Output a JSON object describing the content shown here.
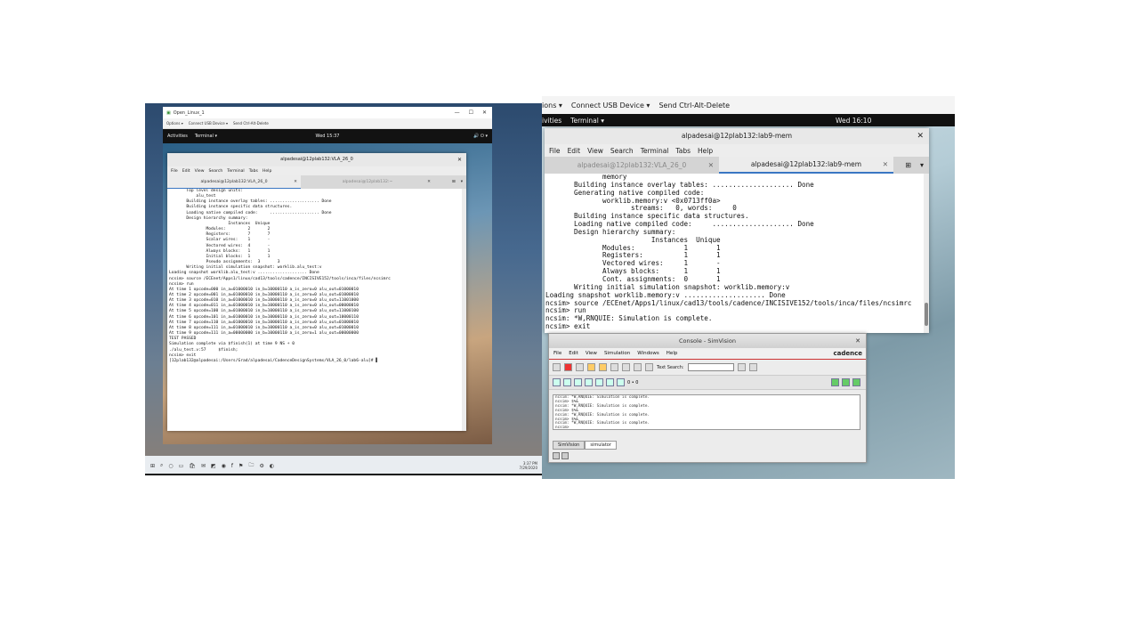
{
  "left": {
    "rdp_title": "Open_Linux_1",
    "rdp_toolbar": [
      "Options ▾",
      "Connect USB Device ▾",
      "Send Ctrl-Alt-Delete"
    ],
    "gnome": {
      "activities": "Activities",
      "app": "Terminal ▾",
      "clock": "Wed 15:37"
    },
    "terminal": {
      "title": "alpadesai@12plab132:VLA_26_0",
      "menu": [
        "File",
        "Edit",
        "View",
        "Search",
        "Terminal",
        "Tabs",
        "Help"
      ],
      "tabs": [
        "alpadesai@12plab132:VLA_26_0",
        "alpadesai@12plab132:~"
      ],
      "lines": [
        "       Top level design units:",
        "           alu_test",
        "       Building instance overlay tables: .................... Done",
        "       Building instance specific data structures.",
        "       Loading native compiled code:     .................... Done",
        "       Design hierarchy summary:",
        "                        Instances  Unique",
        "               Modules:         2       2",
        "               Registers:       7       7",
        "               Scalar wires:    1       -",
        "               Vectored wires:  4       -",
        "               Always blocks:   1       1",
        "               Initial blocks:  1       1",
        "               Pseudo assignments:  3       3",
        "       Writing initial simulation snapshot: worklib.alu_test:v",
        "Loading snapshot worklib.alu_test:v .................... Done",
        "ncsim> source /ECEnet/Apps1/linux/cad13/tools/cadence/INCISIVE152/tools/inca/files/ncsimrc",
        "ncsim> run",
        "At time 1 opcode=000 in_a=01000010 in_b=10000110 a_is_zero=0 alu_out=01000010",
        "At time 2 opcode=001 in_a=01000010 in_b=10000110 a_is_zero=0 alu_out=01000010",
        "At time 3 opcode=010 in_a=01000010 in_b=10000110 a_is_zero=0 alu_out=11001000",
        "At time 4 opcode=011 in_a=01000010 in_b=10000110 a_is_zero=0 alu_out=00000010",
        "At time 5 opcode=100 in_a=01000010 in_b=10000110 a_is_zero=0 alu_out=11000100",
        "At time 6 opcode=101 in_a=01000010 in_b=10000110 a_is_zero=0 alu_out=10000110",
        "At time 7 opcode=110 in_a=01000010 in_b=10000110 a_is_zero=0 alu_out=01000010",
        "At time 8 opcode=111 in_a=01000010 in_b=10000110 a_is_zero=0 alu_out=01000010",
        "At time 9 opcode=111 in_a=00000000 in_b=10000110 a_is_zero=1 alu_out=00000000",
        "TEST PASSED",
        "Simulation complete via $finish(1) at time 9 NS + 0",
        "./alu_test.v:57     $finish;",
        "ncsim> exit",
        "[12plab132@alpadesai:/Users/Grad/alpadesai/CadenceDesignSystems/VLA_26_0/lab6-alu]# ▌"
      ]
    },
    "taskbar_clock": [
      "3:37 PM",
      "7/29/2020"
    ]
  },
  "right": {
    "rdp_toolbar": [
      "ions ▾",
      "Connect USB Device ▾",
      "Send Ctrl-Alt-Delete"
    ],
    "gnome": {
      "activities": "ivities",
      "app": "Terminal ▾",
      "clock": "Wed 16:10"
    },
    "terminal": {
      "title": "alpadesai@12plab132:lab9-mem",
      "menu": [
        "File",
        "Edit",
        "View",
        "Search",
        "Terminal",
        "Tabs",
        "Help"
      ],
      "tabs": [
        "alpadesai@12plab132:VLA_26_0",
        "alpadesai@12plab132:lab9-mem"
      ],
      "lines": [
        "              memory",
        "       Building instance overlay tables: .................... Done",
        "       Generating native compiled code:",
        "              worklib.memory:v <0x0713ff0a>",
        "                     streams:   0, words:     0",
        "       Building instance specific data structures.",
        "       Loading native compiled code:     .................... Done",
        "       Design hierarchy summary:",
        "                          Instances  Unique",
        "              Modules:            1       1",
        "              Registers:          1       1",
        "              Vectored wires:     1       -",
        "              Always blocks:      1       1",
        "              Cont. assignments:  0       1",
        "       Writing initial simulation snapshot: worklib.memory:v",
        "Loading snapshot worklib.memory:v .................... Done",
        "ncsim> source /ECEnet/Apps1/linux/cad13/tools/cadence/INCISIVE152/tools/inca/files/ncsimrc",
        "ncsim> run",
        "ncsim: *W,RNQUIE: Simulation is complete.",
        "ncsim> exit"
      ]
    },
    "console": {
      "title": "Console - SimVision",
      "menu": [
        "File",
        "Edit",
        "View",
        "Simulation",
        "Windows",
        "Help"
      ],
      "brand": "cadence",
      "text_search_label": "Text Search:",
      "counter": "0 • 0",
      "output": [
        "ncsim: *W,RNQUIE: Simulation is complete.",
        "ncsim> $%&",
        "ncsim: *W,RNQUIE: Simulation is complete.",
        "ncsim> $%&",
        "ncsim: *W,RNQUIE: Simulation is complete.",
        "ncsim> $%&",
        "ncsim: *W,RNQUIE: Simulation is complete.",
        "ncsim>"
      ],
      "tabs": [
        "SimVision",
        "simulator"
      ]
    }
  }
}
